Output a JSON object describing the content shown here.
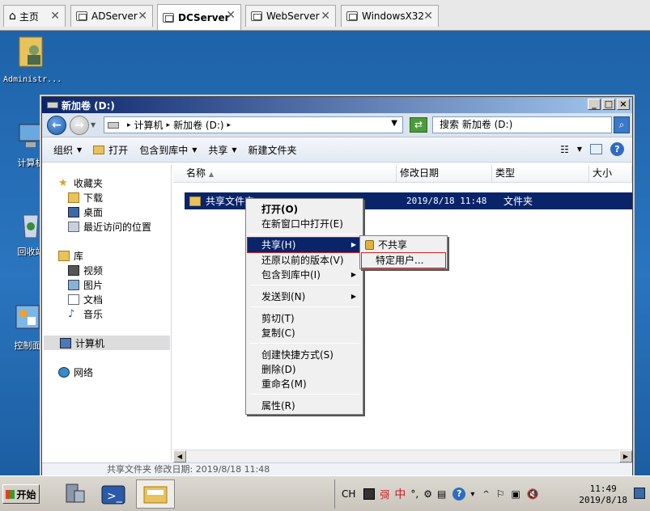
{
  "tabs": [
    {
      "label": "主页",
      "icon": "home-icon"
    },
    {
      "label": "ADServer"
    },
    {
      "label": "DCServer"
    },
    {
      "label": "WebServer"
    },
    {
      "label": "WindowsX32"
    }
  ],
  "desktop": {
    "icons": [
      {
        "label": "Administr...",
        "icon": "user-folder-icon"
      },
      {
        "label": "计算机",
        "icon": "computer-icon"
      },
      {
        "label": "回收站",
        "icon": "recycle-bin-icon"
      },
      {
        "label": "控制面",
        "icon": "control-panel-icon"
      }
    ]
  },
  "window": {
    "title": "新加卷 (D:)",
    "address": {
      "part1": "计算机",
      "part2": "新加卷 (D:)"
    },
    "search_placeholder": "搜索 新加卷 (D:)",
    "toolbar": {
      "organize": "组织",
      "open": "打开",
      "include": "包含到库中",
      "share": "共享",
      "newfolder": "新建文件夹"
    },
    "nav": {
      "favorites": "收藏夹",
      "downloads": "下载",
      "desktop": "桌面",
      "recent": "最近访问的位置",
      "libraries": "库",
      "videos": "视频",
      "pictures": "图片",
      "documents": "文档",
      "music": "音乐",
      "computer": "计算机",
      "network": "网络"
    },
    "columns": {
      "name": "名称",
      "modified": "修改日期",
      "type": "类型",
      "size": "大小"
    },
    "rows": [
      {
        "name": "共享文件夹",
        "modified": "2019/8/18 11:48",
        "type": "文件夹"
      }
    ],
    "details": "共享文件夹  修改日期: 2019/8/18 11:48"
  },
  "context_menu": {
    "open": "打开(O)",
    "open_new": "在新窗口中打开(E)",
    "share": "共享(H)",
    "restore": "还原以前的版本(V)",
    "include": "包含到库中(I)",
    "sendto": "发送到(N)",
    "cut": "剪切(T)",
    "copy": "复制(C)",
    "shortcut": "创建快捷方式(S)",
    "delete": "删除(D)",
    "rename": "重命名(M)",
    "properties": "属性(R)"
  },
  "submenu": {
    "noshare": "不共享",
    "specific": "特定用户..."
  },
  "taskbar": {
    "start": "开始",
    "lang": "CH",
    "ime": "中",
    "time": "11:49",
    "date": "2019/8/18"
  }
}
